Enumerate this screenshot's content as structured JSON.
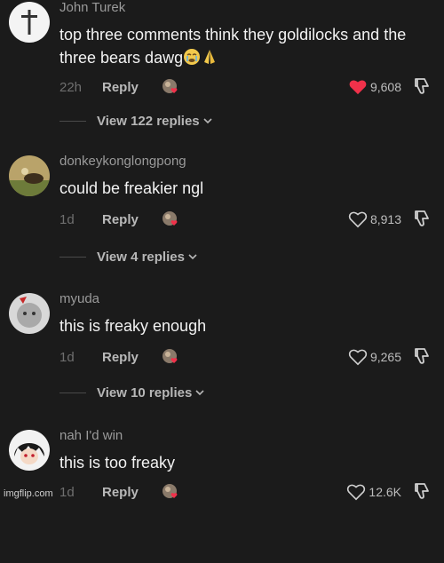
{
  "comments": [
    {
      "username": "John Turek",
      "text": "top three comments think they goldilocks and the three bears dawg",
      "time": "22h",
      "reply_label": "Reply",
      "likes": "9,608",
      "liked": true,
      "view_replies": "View 122 replies"
    },
    {
      "username": "donkeykonglongpong",
      "text": "could be freakier ngl",
      "time": "1d",
      "reply_label": "Reply",
      "likes": "8,913",
      "liked": false,
      "view_replies": "View 4 replies"
    },
    {
      "username": "myuda",
      "text": "this is freaky enough",
      "time": "1d",
      "reply_label": "Reply",
      "likes": "9,265",
      "liked": false,
      "view_replies": "View 10 replies"
    },
    {
      "username": "nah I'd win",
      "text": "this is too freaky",
      "time": "1d",
      "reply_label": "Reply",
      "likes": "12.6K",
      "liked": false
    }
  ],
  "watermark": "imgflip.com",
  "colors": {
    "background": "#1b1b1b",
    "liked_heart": "#f0314a"
  }
}
